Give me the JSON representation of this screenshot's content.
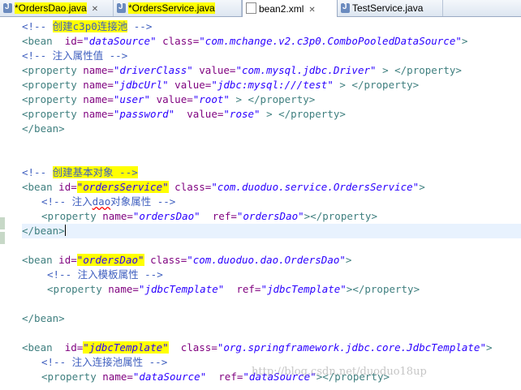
{
  "tabs": [
    {
      "label": "*OrdersDao.java",
      "icon": "java-file-icon",
      "close": "✕"
    },
    {
      "label": "*OrdersService.java",
      "icon": "java-file-icon"
    },
    {
      "label": "bean2.xml",
      "icon": "xml-file-icon",
      "close": "✕"
    },
    {
      "label": "TestService.java",
      "icon": "java-file-icon"
    }
  ],
  "code": {
    "l1": {
      "pre": "<!-- ",
      "cn": "创建c3p0连接池",
      "post": " -->"
    },
    "l2": {
      "open": "<bean",
      "a1": "id=",
      "v1": "\"dataSource\"",
      "a2": "class=",
      "v2": "\"com.mchange.v2.c3p0.ComboPooledDataSource\"",
      "close": ">"
    },
    "l3": {
      "text": "<!-- 注入属性值 -->"
    },
    "l4": {
      "open": "<property",
      "a1": "name=",
      "v1": "\"driverClass\"",
      "a2": "value=",
      "v2": "\"com.mysql.jdbc.Driver\"",
      "close": "> </property>"
    },
    "l5": {
      "open": "<property",
      "a1": "name=",
      "v1": "\"jdbcUrl\"",
      "a2": "value=",
      "v2": "\"jdbc:mysql:///test\"",
      "close": "> </property>"
    },
    "l6": {
      "open": "<property",
      "a1": "name=",
      "v1": "\"user\"",
      "a2": "value=",
      "v2": "\"root\"",
      "close": "> </property>"
    },
    "l7": {
      "open": "<property",
      "a1": "name=",
      "v1": "\"password\"",
      "a2": "value=",
      "v2": "\"rose\"",
      "close": "> </property>"
    },
    "l8": {
      "text": "</bean>"
    },
    "l9": {
      "pre": "<!-- ",
      "cn": "创建基本对象 -->"
    },
    "l10": {
      "open": "<bean",
      "a1": "id=",
      "v1": "\"ordersService\"",
      "a2": "class=",
      "v2": "\"com.duoduo.service.OrdersService\"",
      "close": ">"
    },
    "l11": {
      "pre": "<!-- 注入",
      "sq": "dao",
      "post": "对象属性 -->"
    },
    "l12": {
      "open": "<property",
      "a1": "name=",
      "v1": "\"ordersDao\"",
      "a2": "ref=",
      "v2": "\"ordersDao\"",
      "close": "></property>"
    },
    "l13": {
      "text": "</bean>"
    },
    "l14": {
      "open": "<bean",
      "a1": "id=",
      "v1": "\"ordersDao\"",
      "a2": "class=",
      "v2": "\"com.duoduo.dao.OrdersDao\"",
      "close": ">"
    },
    "l15": {
      "text": "<!-- 注入模板属性 -->"
    },
    "l16": {
      "open": "<property",
      "a1": "name=",
      "v1": "\"jdbcTemplate\"",
      "a2": "ref=",
      "v2": "\"jdbcTemplate\"",
      "close": "></property>"
    },
    "l17": {
      "text": "</bean>"
    },
    "l18": {
      "open": "<bean",
      "a1": "id=",
      "v1": "\"jdbcTemplate\"",
      "a2": "class=",
      "v2": "\"org.springframework.jdbc.core.JdbcTemplate\"",
      "close": ">"
    },
    "l19": {
      "text": "<!-- 注入连接池属性 -->"
    },
    "l20": {
      "open": "<property",
      "a1": "name=",
      "v1": "\"dataSource\"",
      "a2": "ref=",
      "v2": "\"dataSource\"",
      "close": "></property>"
    }
  },
  "watermark": "http://blog.csdn.net/duoduo18up",
  "colors": {
    "comment": "#3f5fbf",
    "tag": "#3f7f7f",
    "attribute": "#7f007f",
    "value": "#2a00ff",
    "highlight": "#ffff00"
  }
}
